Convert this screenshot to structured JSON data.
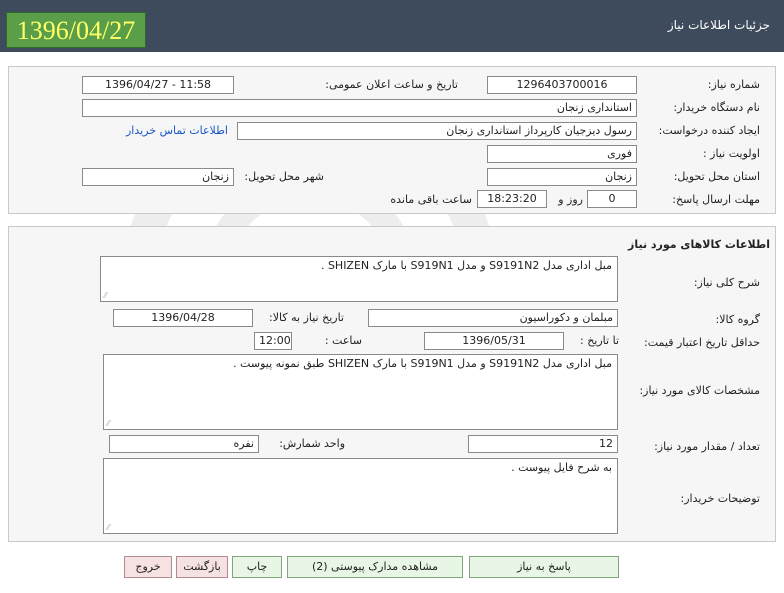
{
  "header": {
    "date": "1396/04/27",
    "title": "جزئیات اطلاعات نیاز"
  },
  "colors": {
    "header_bg": "#3d4b5c",
    "date_badge_bg": "#5a9e4a",
    "date_text": "#ffff66",
    "link": "#1a56c7"
  },
  "details": {
    "need_number_label": "شماره نیاز:",
    "need_number": "1296403700016",
    "announce_label": "تاریخ و ساعت اعلان عمومی:",
    "announce_value": "1396/04/27 - 11:58",
    "buyer_org_label": "نام دستگاه خریدار:",
    "buyer_org": "استانداری زنجان",
    "creator_label": "ایجاد کننده درخواست:",
    "creator": "رسول دیزجیان کارپرداز استانداری زنجان",
    "contact_link": "اطلاعات تماس خریدار",
    "priority_label": "اولویت نیاز :",
    "priority": "فوری",
    "province_label": "استان محل تحویل:",
    "province": "زنجان",
    "city_label": "شهر محل تحویل:",
    "city": "زنجان",
    "deadline_label": "مهلت ارسال پاسخ:",
    "days": "0",
    "days_unit": "روز و",
    "time": "18:23:20",
    "remaining": "ساعت باقی مانده"
  },
  "goods": {
    "section_title": "اطلاعات کالاهای مورد نیاز",
    "summary_label": "شرح کلی نیاز:",
    "summary": "مبل اداری مدل S9191N2 و مدل S919N1 با مارک SHIZEN .",
    "group_label": "گروه کالا:",
    "group": "مبلمان و دکوراسیون",
    "need_date_label": "تاریخ نیاز به کالا:",
    "need_date": "1396/04/28",
    "price_validity_label": "حداقل تاریخ اعتبار قیمت:",
    "until_label": "تا تاریخ :",
    "until_date": "1396/05/31",
    "hour_label": "ساعت :",
    "hour": "12:00",
    "specs_label": "مشخصات کالای مورد نیاز:",
    "specs": "مبل اداری مدل S9191N2 و مدل S919N1 با مارک SHIZEN طبق نمونه پیوست .",
    "qty_label": "تعداد / مقدار مورد نیاز:",
    "qty": "12",
    "unit_label": "واحد شمارش:",
    "unit": "نفره",
    "buyer_desc_label": "توضیحات خریدار:",
    "buyer_desc": "به شرح فایل پیوست ."
  },
  "buttons": {
    "reply": "پاسخ به نیاز",
    "attachments": "مشاهده مدارک پیوستی (2)",
    "print": "چاپ",
    "back": "بازگشت",
    "exit": "خروج"
  }
}
